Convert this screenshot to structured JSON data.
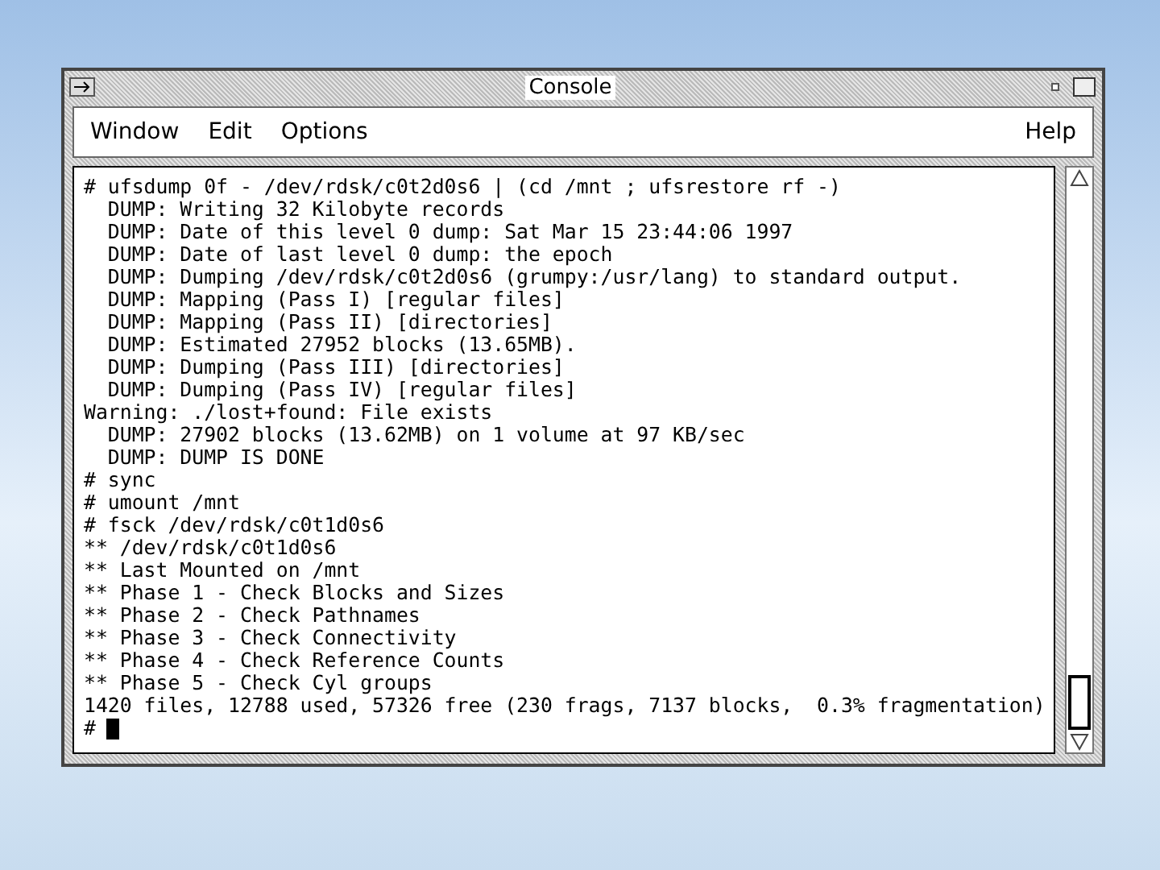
{
  "window": {
    "title": "Console"
  },
  "menu": [
    {
      "label": "Window",
      "kind": "menu"
    },
    {
      "label": "Edit",
      "kind": "menu"
    },
    {
      "label": "Options",
      "kind": "menu"
    },
    {
      "label": "Help",
      "kind": "help"
    }
  ],
  "console": {
    "lines": [
      "# ufsdump 0f - /dev/rdsk/c0t2d0s6 | (cd /mnt ; ufsrestore rf -)",
      "  DUMP: Writing 32 Kilobyte records",
      "  DUMP: Date of this level 0 dump: Sat Mar 15 23:44:06 1997",
      "  DUMP: Date of last level 0 dump: the epoch",
      "  DUMP: Dumping /dev/rdsk/c0t2d0s6 (grumpy:/usr/lang) to standard output.",
      "  DUMP: Mapping (Pass I) [regular files]",
      "  DUMP: Mapping (Pass II) [directories]",
      "  DUMP: Estimated 27952 blocks (13.65MB).",
      "  DUMP: Dumping (Pass III) [directories]",
      "  DUMP: Dumping (Pass IV) [regular files]",
      "Warning: ./lost+found: File exists",
      "  DUMP: 27902 blocks (13.62MB) on 1 volume at 97 KB/sec",
      "  DUMP: DUMP IS DONE",
      "# sync",
      "# umount /mnt",
      "# fsck /dev/rdsk/c0t1d0s6",
      "** /dev/rdsk/c0t1d0s6",
      "** Last Mounted on /mnt",
      "** Phase 1 - Check Blocks and Sizes",
      "** Phase 2 - Check Pathnames",
      "** Phase 3 - Check Connectivity",
      "** Phase 4 - Check Reference Counts",
      "** Phase 5 - Check Cyl groups",
      "1420 files, 12788 used, 57326 free (230 frags, 7137 blocks,  0.3% fragmentation)"
    ],
    "prompt": "#"
  }
}
